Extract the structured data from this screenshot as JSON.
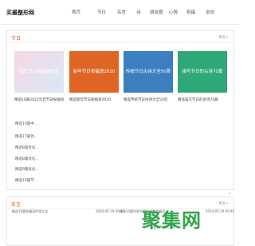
{
  "header": {
    "logo": "买最整形网",
    "nav": [
      "首页",
      "节日",
      "名言",
      "诗",
      "朋友圈",
      "心情",
      "祝福",
      "说说"
    ]
  },
  "section1": {
    "title": "节日",
    "more": "更多+",
    "cards": [
      {
        "title": "国庆节日祝福语精选",
        "caption": "精选10篇2022元旦节日祝福语",
        "bg": "#f3e2ee"
      },
      {
        "title": "新年节日祝福语2020",
        "caption": "精选新年节日祝福语2020",
        "bg": "#de6524"
      },
      {
        "title": "传统节日古诗大全50首",
        "caption": "精选传统节日古诗大全50首",
        "bg": "#3c7ec0"
      },
      {
        "title": "描写节日的古诗70篇",
        "caption": "精选描写节日的古诗70篇",
        "bg": "#2fa878"
      }
    ],
    "list": [
      "精选10篇中...",
      "精选17篇优...",
      "精选8篇优化...",
      "精选8篇优化...",
      "精选9篇优化...",
      "精选10篇节..."
    ]
  },
  "section2": {
    "title": "名言",
    "more": "更多+",
    "rows": [
      "精选10篇祝福语传承大全",
      "2024-05-19 00:47",
      "精选10篇中秋节简短温馨祝福语",
      "2024-05-19 00:40"
    ]
  },
  "watermark": {
    "text": "聚集网",
    "sub": "JUJIWANG.COM"
  }
}
